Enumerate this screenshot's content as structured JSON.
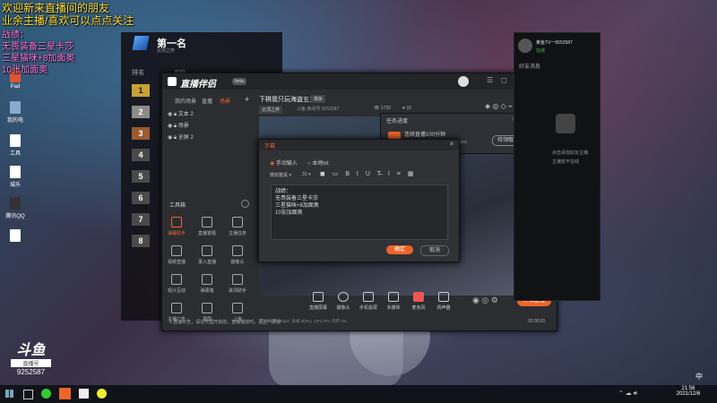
{
  "overlay": {
    "welcome": "欢迎新来直播间的朋友",
    "follow": "业余主播/喜欢可以点点关注",
    "battle_title": "战绩：",
    "line1": "无畏装备三星卡莎",
    "line2": "三星猫咪+8加面奥",
    "line3": "10张加面奥"
  },
  "desktop_icons": [
    {
      "label": "Pad"
    },
    {
      "label": "我的电"
    },
    {
      "label": "工具"
    },
    {
      "label": "城乐"
    },
    {
      "label": "腾讯QQ"
    },
    {
      "label": ""
    }
  ],
  "douyu": {
    "logo": "斗鱼",
    "sub": "直播号",
    "room_id": "9252587"
  },
  "rank": {
    "title": "第一名",
    "subtitle": "云顶之弈",
    "rank_label": "排名",
    "rank_col": "昵称",
    "rows": [
      "1",
      "2",
      "3",
      "4",
      "5",
      "6",
      "7",
      "8"
    ]
  },
  "app": {
    "name": "直播伴侣",
    "version": "beta",
    "tabs": [
      "我的场景",
      "直播",
      "场景"
    ],
    "layers": [
      "文本 2",
      "场景",
      "全屏 2"
    ],
    "room_title": "下棋我只玩海盗五三",
    "tag": "模板",
    "category": "云顶之弈",
    "meta": "斗鱼 房间号 9252587",
    "viewers": "1730",
    "followers": "33",
    "tools_title": "工具箱",
    "tools": [
      "弹幕助手",
      "直播答题",
      "主播任务",
      "视频直播",
      "录入直播",
      "摄像头",
      "观众互动",
      "弹幕墙",
      "歌词助手",
      "主播广告",
      "录屏",
      "上传"
    ],
    "notice": "1.直播公告，请在代理开启前，直播播放时，更上一层楼",
    "bottom_tools": [
      "直播屏幕",
      "摄像头",
      "手机投屏",
      "多媒体",
      "麦克风",
      "扬声器"
    ],
    "start_button": "开始直播",
    "status": [
      "直播码率 0Kbps",
      "丢帧 0(0%)",
      "CPU 0%",
      "内存 0%"
    ],
    "timer": "02:00:01"
  },
  "task": {
    "title": "任务进度",
    "item": "连续直播100分钟",
    "progress": 0.7,
    "button": "待领取"
  },
  "text_dialog": {
    "title": "字幕",
    "mode1": "手动输入",
    "mode2": "本地txt",
    "font": "微软雅黑",
    "size": "31",
    "content": [
      "战绩：",
      "无畏装备三星卡莎",
      "三星猫咪+8加面奥",
      "10张加面奥"
    ],
    "ok": "确定",
    "cancel": "取消"
  },
  "chat": {
    "name": "某鱼TV一9552587",
    "status": "在线",
    "tab": "好友消息",
    "msg1": "点击添加好友主播",
    "msg2": "主播暂不在线"
  },
  "taskbar": {
    "time": "21:56",
    "date": "2021/12/6",
    "ime": "中"
  },
  "colors": {
    "accent": "#f0642a",
    "yellow": "#ffdf3a",
    "pink": "#ff7ee8"
  }
}
